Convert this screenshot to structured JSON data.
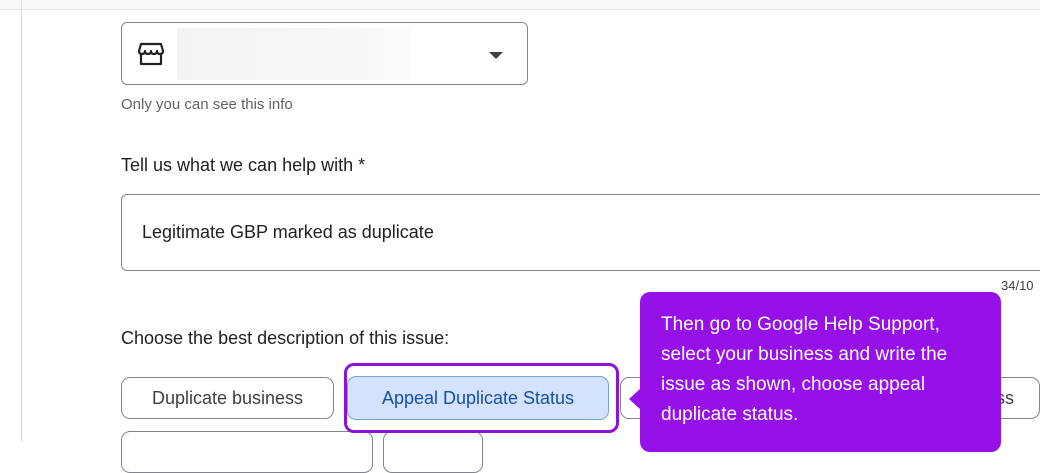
{
  "form": {
    "business_select": {
      "icon": "storefront-icon",
      "value": ""
    },
    "helper_text": "Only you can see this info",
    "help_label": "Tell us what we can help with *",
    "help_value": "Legitimate GBP marked as duplicate",
    "char_counter": "34/10",
    "issue_label": "Choose the best description of this issue:",
    "chips": [
      {
        "label": "Duplicate business",
        "selected": false
      },
      {
        "label": "Appeal Duplicate Status",
        "selected": true
      },
      {
        "label": "ss",
        "selected": false
      },
      {
        "label": "",
        "selected": false
      },
      {
        "label": "",
        "selected": false
      }
    ]
  },
  "callout": {
    "text": "Then go to Google Help Support, select your business and write the issue as shown, choose appeal duplicate status."
  },
  "colors": {
    "callout_bg": "#9610e8",
    "highlight_border": "#8c13d6",
    "selected_chip_bg": "#d3e3fd",
    "selected_chip_text": "#174ea6"
  }
}
